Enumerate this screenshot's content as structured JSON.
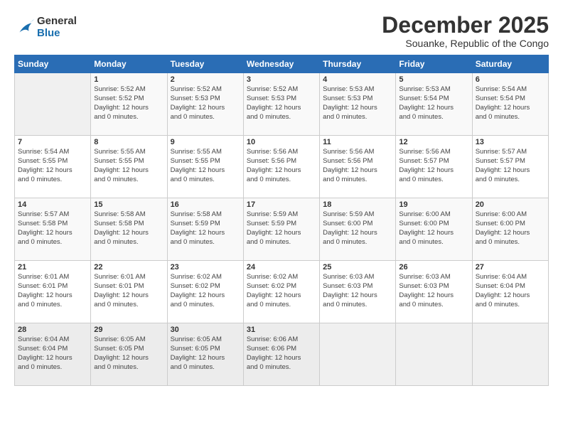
{
  "logo": {
    "general": "General",
    "blue": "Blue"
  },
  "title": "December 2025",
  "subtitle": "Souanke, Republic of the Congo",
  "weekdays": [
    "Sunday",
    "Monday",
    "Tuesday",
    "Wednesday",
    "Thursday",
    "Friday",
    "Saturday"
  ],
  "weeks": [
    [
      {
        "day": "",
        "info": ""
      },
      {
        "day": "1",
        "info": "Sunrise: 5:52 AM\nSunset: 5:52 PM\nDaylight: 12 hours\nand 0 minutes."
      },
      {
        "day": "2",
        "info": "Sunrise: 5:52 AM\nSunset: 5:53 PM\nDaylight: 12 hours\nand 0 minutes."
      },
      {
        "day": "3",
        "info": "Sunrise: 5:52 AM\nSunset: 5:53 PM\nDaylight: 12 hours\nand 0 minutes."
      },
      {
        "day": "4",
        "info": "Sunrise: 5:53 AM\nSunset: 5:53 PM\nDaylight: 12 hours\nand 0 minutes."
      },
      {
        "day": "5",
        "info": "Sunrise: 5:53 AM\nSunset: 5:54 PM\nDaylight: 12 hours\nand 0 minutes."
      },
      {
        "day": "6",
        "info": "Sunrise: 5:54 AM\nSunset: 5:54 PM\nDaylight: 12 hours\nand 0 minutes."
      }
    ],
    [
      {
        "day": "7",
        "info": "Sunrise: 5:54 AM\nSunset: 5:55 PM\nDaylight: 12 hours\nand 0 minutes."
      },
      {
        "day": "8",
        "info": "Sunrise: 5:55 AM\nSunset: 5:55 PM\nDaylight: 12 hours\nand 0 minutes."
      },
      {
        "day": "9",
        "info": "Sunrise: 5:55 AM\nSunset: 5:55 PM\nDaylight: 12 hours\nand 0 minutes."
      },
      {
        "day": "10",
        "info": "Sunrise: 5:56 AM\nSunset: 5:56 PM\nDaylight: 12 hours\nand 0 minutes."
      },
      {
        "day": "11",
        "info": "Sunrise: 5:56 AM\nSunset: 5:56 PM\nDaylight: 12 hours\nand 0 minutes."
      },
      {
        "day": "12",
        "info": "Sunrise: 5:56 AM\nSunset: 5:57 PM\nDaylight: 12 hours\nand 0 minutes."
      },
      {
        "day": "13",
        "info": "Sunrise: 5:57 AM\nSunset: 5:57 PM\nDaylight: 12 hours\nand 0 minutes."
      }
    ],
    [
      {
        "day": "14",
        "info": "Sunrise: 5:57 AM\nSunset: 5:58 PM\nDaylight: 12 hours\nand 0 minutes."
      },
      {
        "day": "15",
        "info": "Sunrise: 5:58 AM\nSunset: 5:58 PM\nDaylight: 12 hours\nand 0 minutes."
      },
      {
        "day": "16",
        "info": "Sunrise: 5:58 AM\nSunset: 5:59 PM\nDaylight: 12 hours\nand 0 minutes."
      },
      {
        "day": "17",
        "info": "Sunrise: 5:59 AM\nSunset: 5:59 PM\nDaylight: 12 hours\nand 0 minutes."
      },
      {
        "day": "18",
        "info": "Sunrise: 5:59 AM\nSunset: 6:00 PM\nDaylight: 12 hours\nand 0 minutes."
      },
      {
        "day": "19",
        "info": "Sunrise: 6:00 AM\nSunset: 6:00 PM\nDaylight: 12 hours\nand 0 minutes."
      },
      {
        "day": "20",
        "info": "Sunrise: 6:00 AM\nSunset: 6:00 PM\nDaylight: 12 hours\nand 0 minutes."
      }
    ],
    [
      {
        "day": "21",
        "info": "Sunrise: 6:01 AM\nSunset: 6:01 PM\nDaylight: 12 hours\nand 0 minutes."
      },
      {
        "day": "22",
        "info": "Sunrise: 6:01 AM\nSunset: 6:01 PM\nDaylight: 12 hours\nand 0 minutes."
      },
      {
        "day": "23",
        "info": "Sunrise: 6:02 AM\nSunset: 6:02 PM\nDaylight: 12 hours\nand 0 minutes."
      },
      {
        "day": "24",
        "info": "Sunrise: 6:02 AM\nSunset: 6:02 PM\nDaylight: 12 hours\nand 0 minutes."
      },
      {
        "day": "25",
        "info": "Sunrise: 6:03 AM\nSunset: 6:03 PM\nDaylight: 12 hours\nand 0 minutes."
      },
      {
        "day": "26",
        "info": "Sunrise: 6:03 AM\nSunset: 6:03 PM\nDaylight: 12 hours\nand 0 minutes."
      },
      {
        "day": "27",
        "info": "Sunrise: 6:04 AM\nSunset: 6:04 PM\nDaylight: 12 hours\nand 0 minutes."
      }
    ],
    [
      {
        "day": "28",
        "info": "Sunrise: 6:04 AM\nSunset: 6:04 PM\nDaylight: 12 hours\nand 0 minutes."
      },
      {
        "day": "29",
        "info": "Sunrise: 6:05 AM\nSunset: 6:05 PM\nDaylight: 12 hours\nand 0 minutes."
      },
      {
        "day": "30",
        "info": "Sunrise: 6:05 AM\nSunset: 6:05 PM\nDaylight: 12 hours\nand 0 minutes."
      },
      {
        "day": "31",
        "info": "Sunrise: 6:06 AM\nSunset: 6:06 PM\nDaylight: 12 hours\nand 0 minutes."
      },
      {
        "day": "",
        "info": ""
      },
      {
        "day": "",
        "info": ""
      },
      {
        "day": "",
        "info": ""
      }
    ]
  ]
}
